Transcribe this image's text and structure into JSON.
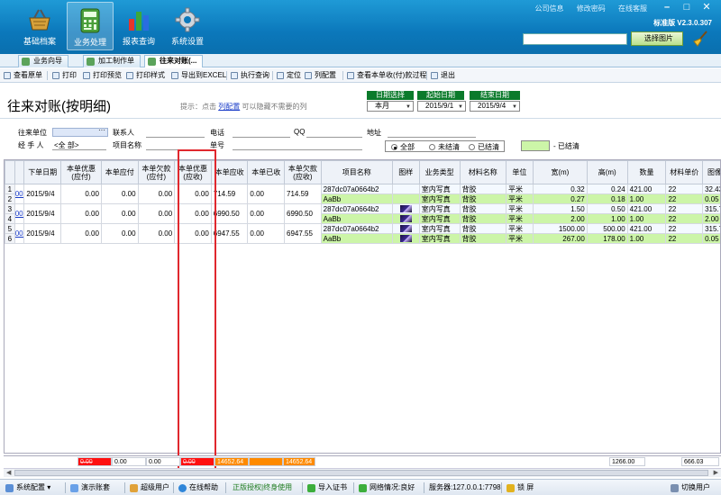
{
  "header": {
    "nav": [
      {
        "label": "基础档案",
        "icon": "basket-icon"
      },
      {
        "label": "业务处理",
        "icon": "calculator-icon"
      },
      {
        "label": "报表查询",
        "icon": "bar-chart-icon"
      },
      {
        "label": "系统设置",
        "icon": "gear-icon"
      }
    ],
    "links": [
      "公司信息",
      "修改密码",
      "在线客服"
    ],
    "version": "标准版 V2.3.0.307",
    "image_search_placeholder": "",
    "image_button": "选择图片"
  },
  "tabs": [
    {
      "label": "业务向导"
    },
    {
      "label": "加工制作单"
    },
    {
      "label": "往来对账(..."
    }
  ],
  "toolbar": [
    "查看原单",
    "打印",
    "打印预览",
    "打印样式",
    "导出到EXCEL",
    "执行查询",
    "定位",
    "列配置",
    "查看本单收(付)款过程",
    "退出"
  ],
  "page": {
    "title": "往来对账(按明细)",
    "hint_prefix": "提示：点击",
    "hint_link": "列配置",
    "hint_suffix": "可以隐藏不需要的列"
  },
  "dates": {
    "select_label": "日期选择",
    "select_value": "本月",
    "start_label": "起始日期",
    "start_value": "2015/9/1",
    "end_label": "结束日期",
    "end_value": "2015/9/4"
  },
  "filters": {
    "partner_label": "往来单位",
    "partner_value": "",
    "contact_label": "联系人",
    "phone_label": "电话",
    "qq_label": "QQ",
    "address_label": "地址",
    "handler_label": "经 手 人",
    "handler_value": "<全 部>",
    "project_label": "项目名称",
    "order_label": "单号",
    "radio_all": "全部",
    "radio_unsettled": "未结清",
    "radio_settled": "已结清",
    "legend_label": "- 已结清"
  },
  "table": {
    "columns": [
      "",
      "下单日期",
      "本单优惠\n(应付)",
      "本单应付",
      "本单欠款\n(应付)",
      "本单优惠\n(应收)",
      "本单应收",
      "本单已收",
      "本单欠款\n(应收)",
      "项目名称",
      "图样",
      "业务类型",
      "材料名称",
      "单位",
      "宽(m)",
      "高(m)",
      "数量",
      "材料单价",
      "图像面积"
    ],
    "orders": [
      {
        "id": "001",
        "date": "2015/9/4",
        "disc_pay": "0.00",
        "payable": "0.00",
        "owed_pay": "0.00",
        "disc_recv": "0.00",
        "receivable": "714.59",
        "received": "0.00",
        "owed_recv": "714.59",
        "items": [
          {
            "row": "1",
            "project": "287dc07a0664b2",
            "has_thumb": false,
            "biz": "室内写真",
            "material": "背胶",
            "unit": "平米",
            "w": "0.32",
            "h": "0.24",
            "qty": "421.00",
            "price": "22",
            "area": "32.43"
          },
          {
            "row": "2",
            "project": "AaBb",
            "has_thumb": false,
            "biz": "室内写真",
            "material": "背胶",
            "unit": "平米",
            "w": "0.27",
            "h": "0.18",
            "qty": "1.00",
            "price": "22",
            "area": "0.05"
          }
        ]
      },
      {
        "id": "002",
        "date": "2015/9/4",
        "disc_pay": "0.00",
        "payable": "0.00",
        "owed_pay": "0.00",
        "disc_recv": "0.00",
        "receivable": "6990.50",
        "received": "0.00",
        "owed_recv": "6990.50",
        "items": [
          {
            "row": "3",
            "project": "287dc07a0664b2",
            "has_thumb": true,
            "biz": "室内写真",
            "material": "背胶",
            "unit": "平米",
            "w": "1.50",
            "h": "0.50",
            "qty": "421.00",
            "price": "22",
            "area": "315.75"
          },
          {
            "row": "4",
            "project": "AaBb",
            "has_thumb": true,
            "biz": "室内写真",
            "material": "背胶",
            "unit": "平米",
            "w": "2.00",
            "h": "1.00",
            "qty": "1.00",
            "price": "22",
            "area": "2.00"
          }
        ]
      },
      {
        "id": "003",
        "date": "2015/9/4",
        "disc_pay": "0.00",
        "payable": "0.00",
        "owed_pay": "0.00",
        "disc_recv": "0.00",
        "receivable": "6947.55",
        "received": "0.00",
        "owed_recv": "6947.55",
        "items": [
          {
            "row": "5",
            "project": "287dc07a0664b2",
            "has_thumb": true,
            "biz": "室内写真",
            "material": "背胶",
            "unit": "平米",
            "w": "1500.00",
            "h": "500.00",
            "qty": "421.00",
            "price": "22",
            "area": "315.75"
          },
          {
            "row": "6",
            "project": "AaBb",
            "has_thumb": true,
            "biz": "室内写真",
            "material": "背胶",
            "unit": "平米",
            "w": "267.00",
            "h": "178.00",
            "qty": "1.00",
            "price": "22",
            "area": "0.05"
          }
        ]
      }
    ],
    "totals": {
      "disc_pay": "0.00",
      "payable": "0.00",
      "owed_pay": "0.00",
      "disc_recv": "0.00",
      "receivable": "14652.64",
      "owed_recv": "14652.64",
      "qty": "1266.00",
      "area": "666.03"
    }
  },
  "statusbar": [
    "系统配置",
    "演示账套",
    "超级用户",
    "在线帮助",
    "正版授权|终身使用",
    "导入证书",
    "网络情况:良好",
    "服务器:127.0.0.1:7798",
    "锁 屏",
    "切换用户"
  ],
  "colors": {
    "header_blue": "#0b78bb",
    "settled_green": "#ccf5a8",
    "highlight_red": "#e0282e",
    "total_orange": "#ff8a00"
  }
}
